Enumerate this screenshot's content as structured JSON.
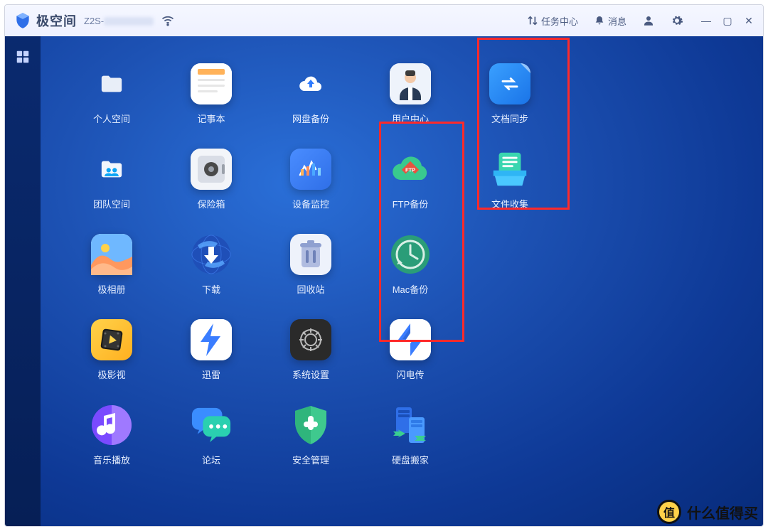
{
  "titlebar": {
    "brand": "极空间",
    "device_prefix": "Z2S-",
    "task_center": "任务中心",
    "messages": "消息"
  },
  "apps": [
    {
      "id": "personal-space",
      "label": "个人空间"
    },
    {
      "id": "notepad",
      "label": "记事本"
    },
    {
      "id": "cloud-backup",
      "label": "网盘备份"
    },
    {
      "id": "user-center",
      "label": "用户中心"
    },
    {
      "id": "doc-sync",
      "label": "文档同步"
    },
    {
      "id": "blank-0",
      "label": ""
    },
    {
      "id": "team-space",
      "label": "团队空间"
    },
    {
      "id": "safe-box",
      "label": "保险箱"
    },
    {
      "id": "device-monitor",
      "label": "设备监控"
    },
    {
      "id": "ftp-backup",
      "label": "FTP备份"
    },
    {
      "id": "file-collect",
      "label": "文件收集"
    },
    {
      "id": "blank-1",
      "label": ""
    },
    {
      "id": "photo-album",
      "label": "极相册"
    },
    {
      "id": "download",
      "label": "下载"
    },
    {
      "id": "recycle-bin",
      "label": "回收站"
    },
    {
      "id": "mac-backup",
      "label": "Mac备份"
    },
    {
      "id": "blank-2",
      "label": ""
    },
    {
      "id": "blank-3",
      "label": ""
    },
    {
      "id": "video",
      "label": "极影视"
    },
    {
      "id": "xunlei",
      "label": "迅雷"
    },
    {
      "id": "system-settings",
      "label": "系统设置"
    },
    {
      "id": "lightning-transfer",
      "label": "闪电传"
    },
    {
      "id": "blank-4",
      "label": ""
    },
    {
      "id": "blank-5",
      "label": ""
    },
    {
      "id": "music-play",
      "label": "音乐播放"
    },
    {
      "id": "forum",
      "label": "论坛"
    },
    {
      "id": "security-mgmt",
      "label": "安全管理"
    },
    {
      "id": "disk-migrate",
      "label": "硬盘搬家"
    }
  ],
  "watermark": {
    "text": "什么值得买",
    "badge": "值"
  }
}
